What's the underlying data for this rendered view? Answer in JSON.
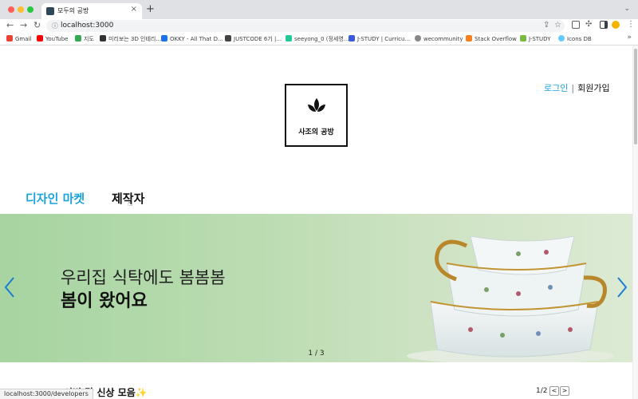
{
  "browser": {
    "tab_title": "모두의 공방",
    "new_tab_icon": "plus-icon",
    "url": "localhost:3000",
    "bookmarks": [
      "Gmail",
      "YouTube",
      "지도",
      "미리보는 3D 인테리...",
      "OKKY - All That D...",
      "JUSTCODE 6기 |...",
      "seeyong_0 (정세영...",
      "J-STUDY | Curricu...",
      "wecommunity",
      "Stack Overflow",
      "J-STUDY",
      "Icons DB"
    ],
    "status_url": "localhost:3000/developers"
  },
  "header": {
    "logo_text": "사조의 공방",
    "login": "로그인",
    "separator": "|",
    "signup": "회원가입"
  },
  "main_tabs": {
    "design_market": "디자인 마켓",
    "maker": "제작자"
  },
  "banner": {
    "line1": "우리집 식탁에도 봄봄봄",
    "line2": "봄이 왔어요",
    "indicator": "1 / 3",
    "accent": "#1a7fd4"
  },
  "section": {
    "title": "이번 달 신상 모음",
    "emoji": "✨",
    "pager": "1/2",
    "prev": "<",
    "next": ">"
  },
  "colors": {
    "accent": "#1ba2dd",
    "banner_green": "#a7d4a1"
  }
}
